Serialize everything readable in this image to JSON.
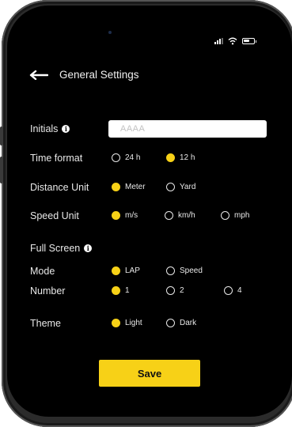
{
  "header": {
    "title": "General Settings",
    "back_icon": "arrow-left-icon"
  },
  "status_bar": {
    "icons": [
      "signal-icon",
      "wifi-icon",
      "battery-icon"
    ]
  },
  "accent_color": "#f7d117",
  "initials": {
    "label": "Initials",
    "placeholder": "AAAA",
    "value": ""
  },
  "time_format": {
    "label": "Time format",
    "options": [
      "24 h",
      "12 h"
    ],
    "selected": "12 h"
  },
  "distance_unit": {
    "label": "Distance Unit",
    "options": [
      "Meter",
      "Yard"
    ],
    "selected": "Meter"
  },
  "speed_unit": {
    "label": "Speed Unit",
    "options": [
      "m/s",
      "km/h",
      "mph"
    ],
    "selected": "m/s"
  },
  "full_screen": {
    "label": "Full Screen",
    "mode": {
      "label": "Mode",
      "options": [
        "LAP",
        "Speed"
      ],
      "selected": "LAP"
    },
    "number": {
      "label": "Number",
      "options": [
        "1",
        "2",
        "4"
      ],
      "selected": "1"
    }
  },
  "theme": {
    "label": "Theme",
    "options": [
      "Light",
      "Dark"
    ],
    "selected": "Light"
  },
  "save_label": "Save"
}
